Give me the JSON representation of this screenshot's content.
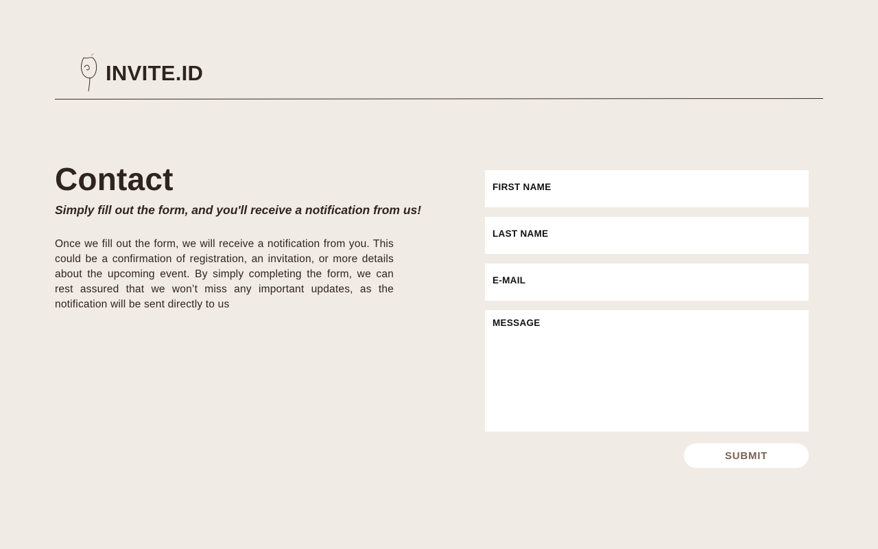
{
  "header": {
    "logo_text": "INVITE.ID",
    "logo_icon": "wine-glass-icon"
  },
  "intro": {
    "title": "Contact",
    "subtitle": "Simply fill out the form, and you'll receive a notification from us!",
    "body": "Once we fill out the form, we will receive a notification from you. This could be a confirmation of registration, an invitation, or more details about the upcoming event. By simply completing the form, we can rest assured that we won’t miss any important updates, as the notification will be sent directly to us"
  },
  "form": {
    "first_name_label": "FIRST NAME",
    "last_name_label": "LAST NAME",
    "email_label": "E-MAIL",
    "message_label": "MESSAGE",
    "first_name_value": "",
    "last_name_value": "",
    "email_value": "",
    "message_value": "",
    "submit_label": "SUBMIT"
  },
  "colors": {
    "background": "#f0ebe4",
    "text": "#2f2320",
    "submit_text": "#7b6250",
    "field_bg": "#ffffff"
  }
}
